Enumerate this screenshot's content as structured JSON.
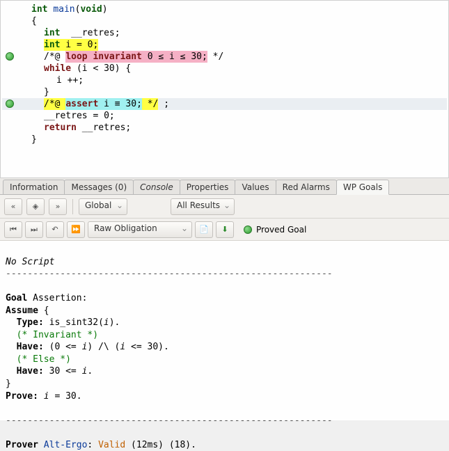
{
  "code": {
    "l1_type": "int",
    "l1_fn": "main",
    "l1_paren": "(",
    "l1_void": "void",
    "l1_rest": ")",
    "l2": "{",
    "l3_type": "int",
    "l3_rest": "  __retres;",
    "l4_type": "int",
    "l4_mid": " i = 0",
    "l4_semi": ";",
    "l5_pre": "/*@ ",
    "l5_kw": "loop invariant",
    "l5_expr": " 0 ≤ i ≤ 30;",
    "l5_post": " */",
    "l6_kw": "while",
    "l6_rest": " (i < 30) {",
    "l7": "i ++;",
    "l8": "}",
    "l9_pre": "/*@ ",
    "l9_kw": "assert",
    "l9_expr": " i ≡ 30;",
    "l9_post": " */",
    "l9_tail": " ;",
    "l10": "__retres = 0;",
    "l11_kw": "return",
    "l11_rest": " __retres;",
    "l12": "}"
  },
  "tabs": {
    "information": "Information",
    "messages": "Messages (0)",
    "console": "Console",
    "properties": "Properties",
    "values": "Values",
    "redalarms": "Red Alarms",
    "wpgoals": "WP Goals"
  },
  "toolbar": {
    "scope": "Global",
    "results": "All Results",
    "obligation": "Raw Obligation",
    "proved": "Proved Goal"
  },
  "goal": {
    "noscript": "No Script",
    "hr": "------------------------------------------------------------",
    "title1": "Goal",
    "title2": " Assertion:",
    "assume": "Assume",
    "brace_open": " {",
    "typelabel": "  Type:",
    "typeexpr_a": " is_sint32(",
    "typeexpr_i": "i",
    "typeexpr_b": ").",
    "inv": "  (* Invariant *)",
    "have1": "  Have:",
    "have1expr_a": " (0 <= ",
    "have1expr_i1": "i",
    "have1expr_b": ") /\\ (",
    "have1expr_i2": "i",
    "have1expr_c": " <= 30).",
    "else": "  (* Else *)",
    "have2": "  Have:",
    "have2expr_a": " 30 <= ",
    "have2expr_i": "i",
    "have2expr_b": ".",
    "brace_close": "}",
    "prove": "Prove:",
    "proveexpr_a": " ",
    "proveexpr_i": "i",
    "proveexpr_b": " = 30.",
    "prover_label": "Prover ",
    "prover_name": "Alt-Ergo",
    "prover_sep": ": ",
    "prover_status": "Valid",
    "prover_time": " (12ms) (18)."
  }
}
